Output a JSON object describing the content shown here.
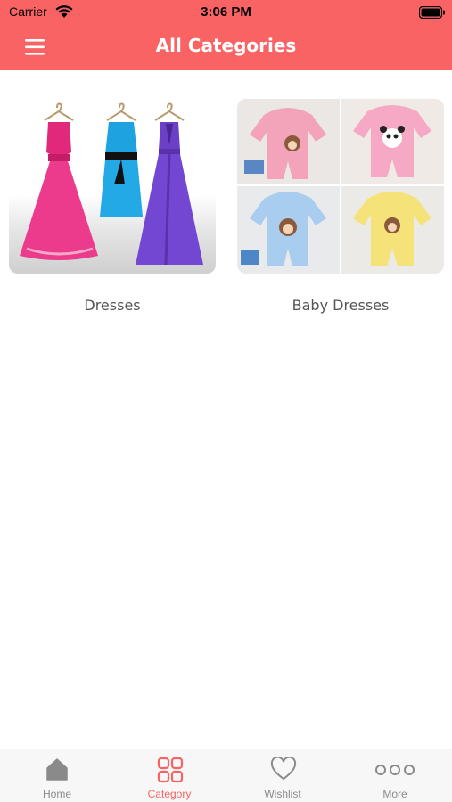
{
  "status_bar": {
    "carrier": "Carrier",
    "time": "3:06 PM"
  },
  "header": {
    "title": "All Categories",
    "menu_icon": "hamburger-menu-icon"
  },
  "categories": [
    {
      "label": "Dresses"
    },
    {
      "label": "Baby Dresses"
    }
  ],
  "tab_bar": {
    "items": [
      {
        "label": "Home",
        "icon": "home-icon",
        "active": false
      },
      {
        "label": "Category",
        "icon": "grid-icon",
        "active": true
      },
      {
        "label": "Wishlist",
        "icon": "heart-icon",
        "active": false
      },
      {
        "label": "More",
        "icon": "more-icon",
        "active": false
      }
    ]
  },
  "colors": {
    "accent": "#f96364",
    "inactive": "#8a8a8a",
    "background": "#ffffff"
  }
}
